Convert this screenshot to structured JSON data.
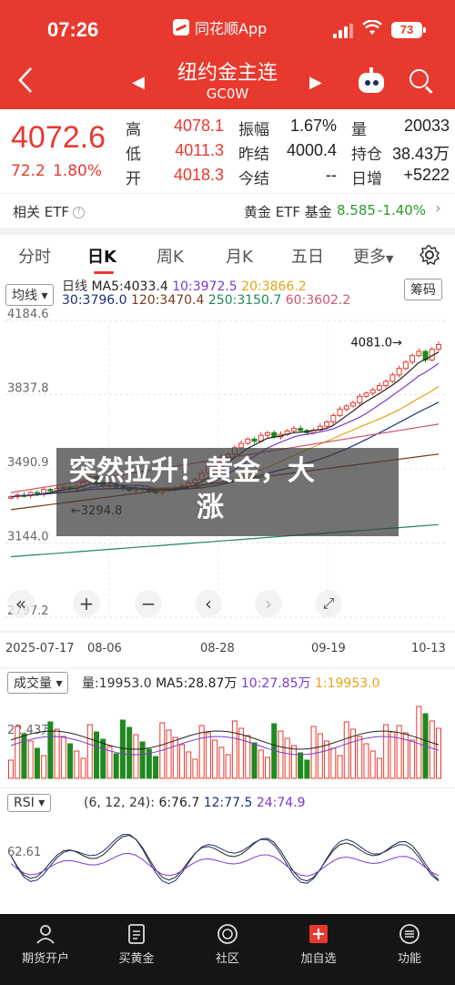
{
  "status": {
    "time": "07:26",
    "app_name": "同花顺App",
    "battery": "73"
  },
  "header": {
    "title": "纽约金主连",
    "code": "GC0W"
  },
  "quote": {
    "price": "4072.6",
    "change": "72.2",
    "change_pct": "1.80%",
    "rows": [
      {
        "l1": "高",
        "v1": "4078.1",
        "l2": "振幅",
        "v2": "1.67%",
        "l3": "量",
        "v3": "20033"
      },
      {
        "l1": "低",
        "v1": "4011.3",
        "l2": "昨结",
        "v2": "4000.4",
        "l3": "持仓",
        "v3": "38.43万"
      },
      {
        "l1": "开",
        "v1": "4018.3",
        "l2": "今结",
        "v2": "--",
        "l3": "日增",
        "v3": "+5222"
      }
    ]
  },
  "etf": {
    "label": "相关 ETF",
    "name": "黄金 ETF 基金",
    "price": "8.585",
    "pct": "-1.40%"
  },
  "tabs": [
    "分时",
    "日K",
    "周K",
    "月K",
    "五日",
    "更多"
  ],
  "kline": {
    "indicator_btn": "均线",
    "period": "日线",
    "ma5": "MA5:4033.4",
    "ma10": "10:3972.5",
    "ma20": "20:3866.2",
    "ma30": "30:3796.0",
    "ma120": "120:3470.4",
    "ma250": "250:3150.7",
    "ma60": "60:3602.2",
    "chip_btn": "筹码",
    "yticks": [
      "4184.6",
      "3837.8",
      "3490.9",
      "3144.0",
      "2797.2"
    ],
    "high_mark": "4081.0",
    "low_mark": "3294.8",
    "dates": [
      "2025-07-17",
      "08-06",
      "08-28",
      "09-19",
      "10-13"
    ]
  },
  "volume": {
    "btn": "成交量",
    "vol": "量:19953.0",
    "ma5": "MA5:28.87万",
    "ma10": "10:27.85万",
    "ma1": "1:19953.0",
    "ytick": "22.43万"
  },
  "rsi": {
    "btn": "RSI",
    "params": "(6, 12, 24):",
    "r6": "6:76.7",
    "r12": "12:77.5",
    "r24": "24:74.9",
    "ytick": "62.61"
  },
  "news_overlay": {
    "line1": "突然拉升！黄金，大",
    "line2": "涨"
  },
  "bottom_nav": [
    "期货开户",
    "买黄金",
    "社区",
    "加自选",
    "功能"
  ],
  "colors": {
    "brand": "#e8392e",
    "up": "#e8392e",
    "down": "#1f8a1f",
    "ma5": "#222222",
    "ma10": "#7a3ad0",
    "ma20": "#e6a316"
  },
  "chart_data": {
    "type": "candlestick",
    "title": "",
    "ylim": [
      2797.2,
      4184.6
    ],
    "x": [
      "2025-07-17",
      "08-06",
      "08-28",
      "09-19",
      "10-13"
    ],
    "ma_lines": [
      "MA5",
      "MA10",
      "MA20",
      "MA30",
      "MA60",
      "MA120",
      "MA250"
    ],
    "closes": [
      3360,
      3368,
      3365,
      3380,
      3372,
      3395,
      3388,
      3400,
      3405,
      3398,
      3410,
      3430,
      3455,
      3420,
      3410,
      3415,
      3405,
      3398,
      3390,
      3400,
      3395,
      3385,
      3380,
      3392,
      3398,
      3402,
      3410,
      3425,
      3440,
      3470,
      3505,
      3520,
      3545,
      3560,
      3590,
      3610,
      3630,
      3620,
      3648,
      3660,
      3640,
      3652,
      3668,
      3680,
      3670,
      3660,
      3672,
      3690,
      3710,
      3740,
      3770,
      3785,
      3800,
      3830,
      3845,
      3860,
      3880,
      3900,
      3930,
      3960,
      3990,
      4020,
      4040,
      4000,
      4050,
      4072
    ]
  }
}
